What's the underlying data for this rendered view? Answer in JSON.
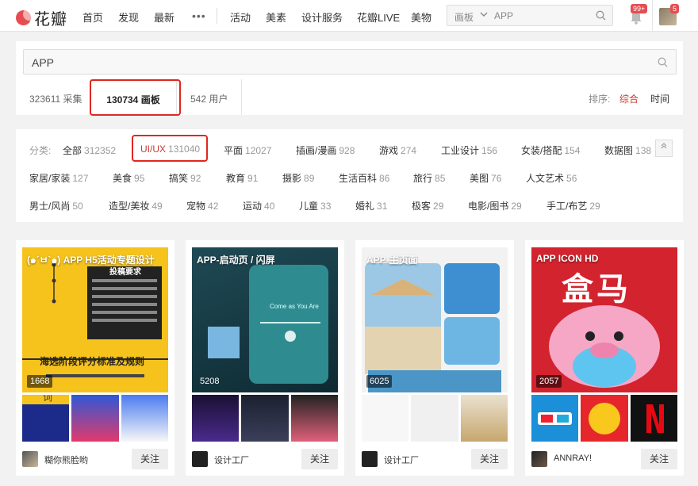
{
  "topnav": {
    "logo_text": "花瓣",
    "items": [
      "首页",
      "发现",
      "最新"
    ],
    "more": "•••",
    "items2": [
      "活动",
      "美素",
      "设计服务",
      "花瓣LIVE",
      "美物"
    ],
    "search_scope": "画板",
    "search_value": "APP",
    "notify_badge": "99+",
    "avatar_badge": "5"
  },
  "search": {
    "query": "APP",
    "tabs": [
      {
        "count": "323611",
        "label": "采集"
      },
      {
        "count": "130734",
        "label": "画板"
      },
      {
        "count": "542",
        "label": "用户"
      }
    ],
    "sort_label": "排序:",
    "sort_options": [
      "综合",
      "时间"
    ]
  },
  "filters": {
    "label": "分类:",
    "items": [
      {
        "name": "全部",
        "count": "312352"
      },
      {
        "name": "UI/UX",
        "count": "131040"
      },
      {
        "name": "平面",
        "count": "12027"
      },
      {
        "name": "插画/漫画",
        "count": "928"
      },
      {
        "name": "游戏",
        "count": "274"
      },
      {
        "name": "工业设计",
        "count": "156"
      },
      {
        "name": "女装/搭配",
        "count": "154"
      },
      {
        "name": "数据图",
        "count": "138"
      },
      {
        "name": "家居/家装",
        "count": "127"
      },
      {
        "name": "美食",
        "count": "95"
      },
      {
        "name": "搞笑",
        "count": "92"
      },
      {
        "name": "教育",
        "count": "91"
      },
      {
        "name": "摄影",
        "count": "89"
      },
      {
        "name": "生活百科",
        "count": "86"
      },
      {
        "name": "旅行",
        "count": "85"
      },
      {
        "name": "美图",
        "count": "76"
      },
      {
        "name": "人文艺术",
        "count": "56"
      },
      {
        "name": "男士/风尚",
        "count": "50"
      },
      {
        "name": "造型/美妆",
        "count": "49"
      },
      {
        "name": "宠物",
        "count": "42"
      },
      {
        "name": "运动",
        "count": "40"
      },
      {
        "name": "儿童",
        "count": "33"
      },
      {
        "name": "婚礼",
        "count": "31"
      },
      {
        "name": "极客",
        "count": "29"
      },
      {
        "name": "电影/图书",
        "count": "29"
      },
      {
        "name": "手工/布艺",
        "count": "29"
      }
    ]
  },
  "boards": [
    {
      "cover_title": "(๑´ㅂ`๑) APP H5活动专题设计",
      "count": "1668",
      "owner": "糊你熊脸哟",
      "follow": "关注",
      "sub1": "投稿要求",
      "sub2": "海选阶段评分标准及规则",
      "sub3": "词"
    },
    {
      "cover_title": "APP-启动页 / 闪屏",
      "count": "5208",
      "owner": "设计工厂",
      "follow": "关注",
      "sub1": "Come as You Are"
    },
    {
      "cover_title": "APP-主页面",
      "count": "6025",
      "owner": "设计工厂",
      "follow": "关注"
    },
    {
      "cover_title": "APP ICON HD",
      "count": "2057",
      "owner": "ANNRAY!",
      "follow": "关注",
      "sub1": "盒马"
    }
  ],
  "colors": {
    "accent": "#c9392f",
    "annotation": "#e0271e",
    "brand": "#e54d51"
  }
}
